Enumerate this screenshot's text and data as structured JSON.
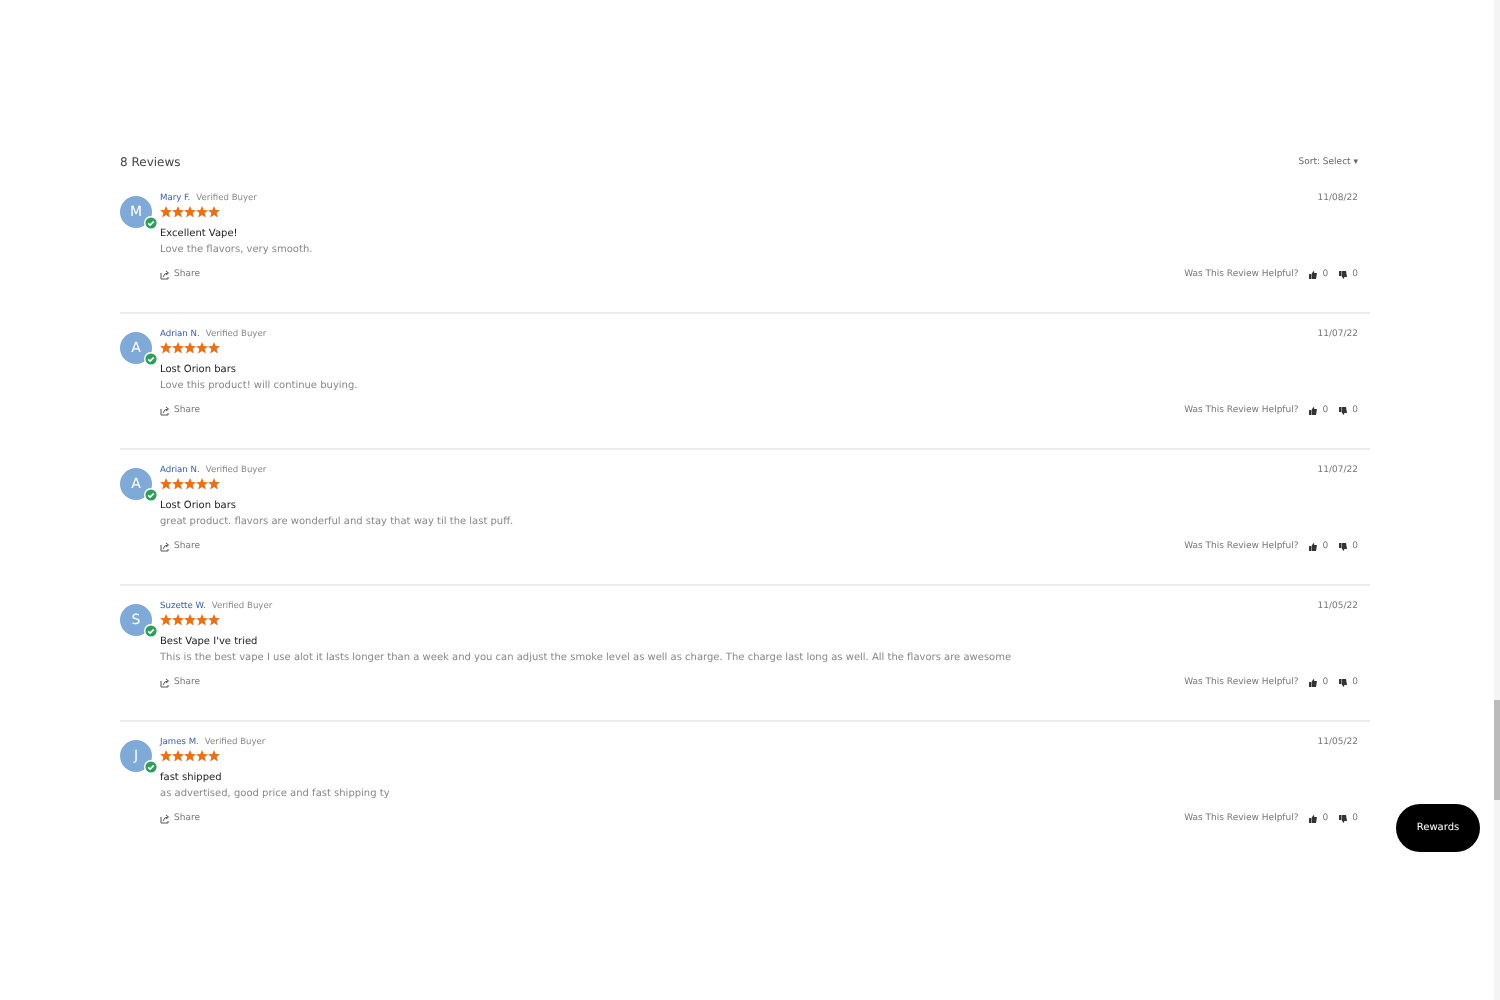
{
  "header": {
    "count": "8 Reviews",
    "sort": "Sort: Select",
    "sort_caret": "▾"
  },
  "reviews": [
    {
      "initial": "M",
      "name": "Mary F.",
      "badge": "Verified Buyer",
      "stars": 5,
      "date": "11/08/22",
      "title": "Excellent Vape!",
      "body": "Love the flavors, very smooth.",
      "share": "Share",
      "helpful": "Was This Review Helpful?",
      "up": "0",
      "down": "0"
    },
    {
      "initial": "A",
      "name": "Adrian N.",
      "badge": "Verified Buyer",
      "stars": 5,
      "date": "11/07/22",
      "title": "Lost Orion bars",
      "body": "Love this product! will continue buying.",
      "share": "Share",
      "helpful": "Was This Review Helpful?",
      "up": "0",
      "down": "0"
    },
    {
      "initial": "A",
      "name": "Adrian N.",
      "badge": "Verified Buyer",
      "stars": 5,
      "date": "11/07/22",
      "title": "Lost Orion bars",
      "body": "great product. flavors are wonderful and stay that way til the last puff.",
      "share": "Share",
      "helpful": "Was This Review Helpful?",
      "up": "0",
      "down": "0"
    },
    {
      "initial": "S",
      "name": "Suzette W.",
      "badge": "Verified Buyer",
      "stars": 5,
      "date": "11/05/22",
      "title": "Best Vape I've tried",
      "body": "This is the best vape I use alot it lasts longer than a week and you can adjust the smoke level as well as charge. The charge last long as well. All the flavors are awesome",
      "share": "Share",
      "helpful": "Was This Review Helpful?",
      "up": "0",
      "down": "0"
    },
    {
      "initial": "J",
      "name": "James M.",
      "badge": "Verified Buyer",
      "stars": 5,
      "date": "11/05/22",
      "title": "fast shipped",
      "body": "as advertised, good price and fast shipping ty",
      "share": "Share",
      "helpful": "Was This Review Helpful?",
      "up": "0",
      "down": "0"
    }
  ],
  "rewards": "Rewards"
}
